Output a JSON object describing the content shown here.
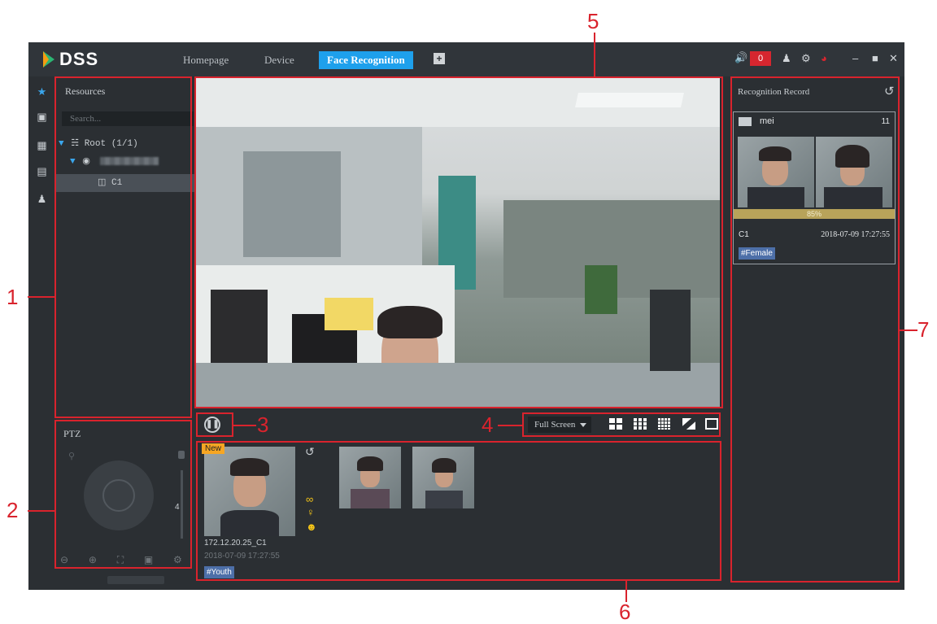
{
  "titlebar": {
    "logo_text": "DSS",
    "tabs": [
      {
        "label": "Homepage"
      },
      {
        "label": "Device"
      },
      {
        "label": "Face Recognition"
      }
    ],
    "add_tab_label": "+",
    "alarm_count": "0"
  },
  "resources": {
    "title": "Resources",
    "search_placeholder": "Search...",
    "tree": {
      "root_label": "Root (1/1)",
      "channel_label": "C1"
    }
  },
  "ptz": {
    "title": "PTZ",
    "step_value": "4"
  },
  "live_controls": {
    "window_mode": "Full Screen"
  },
  "snapshots": {
    "new_badge": "New",
    "channel": "172.12.20.25_C1",
    "time": "2018-07-09 17:27:55",
    "tag": "#Youth"
  },
  "recognition": {
    "title": "Recognition Record",
    "name": "mei",
    "count": "11",
    "similarity": "85%",
    "channel": "C1",
    "time": "2018-07-09 17:27:55",
    "tag": "#Female"
  },
  "callouts": {
    "c1": "1",
    "c2": "2",
    "c3": "3",
    "c4": "4",
    "c5": "5",
    "c6": "6",
    "c7": "7"
  },
  "colors": {
    "accent": "#1ea0ec",
    "alarm": "#d6262f",
    "callout": "#d9232d",
    "tag": "#4d6fa8",
    "panel_bg": "#2b2f33"
  }
}
